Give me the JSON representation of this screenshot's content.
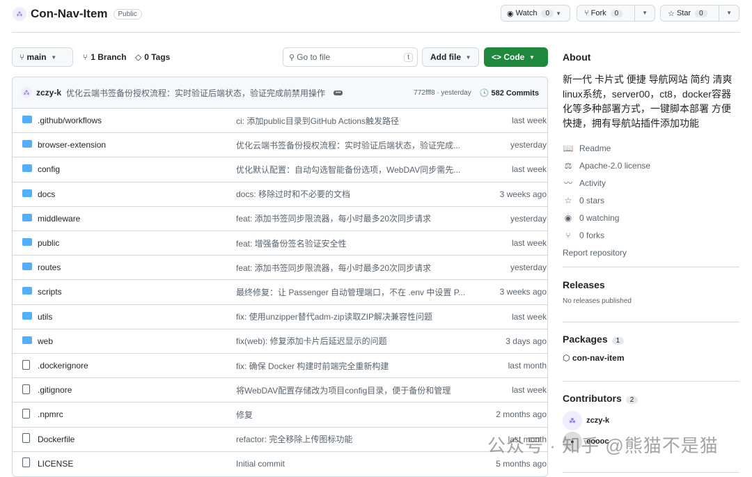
{
  "repo": {
    "name": "Con-Nav-Item",
    "visibility": "Public"
  },
  "actions": {
    "watch": "Watch",
    "watch_count": "0",
    "fork": "Fork",
    "fork_count": "0",
    "star": "Star",
    "star_count": "0"
  },
  "toolbar": {
    "branch": "main",
    "branches": "1 Branch",
    "tags": "0 Tags",
    "search_placeholder": "Go to file",
    "search_key": "t",
    "add_file": "Add file",
    "code": "Code"
  },
  "commit": {
    "author": "zczy-k",
    "message": "优化云端书签备份授权流程：实时验证后端状态，验证完成前禁用操作",
    "hash_time": "772fff8 · yesterday",
    "commits": "582 Commits"
  },
  "files": [
    {
      "name": ".github/workflows",
      "type": "dir",
      "msg": "ci: 添加public目录到GitHub Actions触发路径",
      "date": "last week"
    },
    {
      "name": "browser-extension",
      "type": "dir",
      "msg": "优化云端书签备份授权流程：实时验证后端状态，验证完成...",
      "date": "yesterday"
    },
    {
      "name": "config",
      "type": "dir",
      "msg": "优化默认配置：自动勾选智能备份选项，WebDAV同步需先...",
      "date": "last week"
    },
    {
      "name": "docs",
      "type": "dir",
      "msg": "docs: 移除过时和不必要的文档",
      "date": "3 weeks ago"
    },
    {
      "name": "middleware",
      "type": "dir",
      "msg": "feat: 添加书签同步限流器，每小时最多20次同步请求",
      "date": "yesterday"
    },
    {
      "name": "public",
      "type": "dir",
      "msg": "feat: 增强备份签名验证安全性",
      "date": "last week"
    },
    {
      "name": "routes",
      "type": "dir",
      "msg": "feat: 添加书签同步限流器，每小时最多20次同步请求",
      "date": "yesterday"
    },
    {
      "name": "scripts",
      "type": "dir",
      "msg": "最终修复：让 Passenger 自动管理端口，不在 .env 中设置 P...",
      "date": "3 weeks ago"
    },
    {
      "name": "utils",
      "type": "dir",
      "msg": "fix: 使用unzipper替代adm-zip读取ZIP解决兼容性问题",
      "date": "last week"
    },
    {
      "name": "web",
      "type": "dir",
      "msg": "fix(web): 修复添加卡片后延迟显示的问题",
      "date": "3 days ago"
    },
    {
      "name": ".dockerignore",
      "type": "file",
      "msg": "fix: 确保 Docker 构建时前端完全重新构建",
      "date": "last month"
    },
    {
      "name": ".gitignore",
      "type": "file",
      "msg": "将WebDAV配置存储改为项目config目录，便于备份和管理",
      "date": "last week"
    },
    {
      "name": ".npmrc",
      "type": "file",
      "msg": "修复",
      "date": "2 months ago"
    },
    {
      "name": "Dockerfile",
      "type": "file",
      "msg": "refactor: 完全移除上传图标功能",
      "date": "last month"
    },
    {
      "name": "LICENSE",
      "type": "file",
      "msg": "Initial commit",
      "date": "5 months ago"
    }
  ],
  "about": {
    "title": "About",
    "description": "新一代 卡片式 便捷 导航网站 简约 清爽 linux系统，server00，ct8，docker容器化等多种部署方式，一键脚本部署 方便快捷，拥有导航站插件添加功能",
    "items": [
      "Readme",
      "Apache-2.0 license",
      "Activity",
      "0 stars",
      "0 watching",
      "0 forks"
    ],
    "report": "Report repository"
  },
  "releases": {
    "title": "Releases",
    "text": "No releases published"
  },
  "packages": {
    "title": "Packages",
    "count": "1",
    "item": "con-nav-item"
  },
  "contributors": {
    "title": "Contributors",
    "count": "2",
    "list": [
      "zczy-k",
      "eoooc"
    ]
  },
  "watermark": "公众号 · 知乎 @熊猫不是猫",
  "colors": {
    "accent": "#1f883d",
    "folder": "#54aeff"
  }
}
